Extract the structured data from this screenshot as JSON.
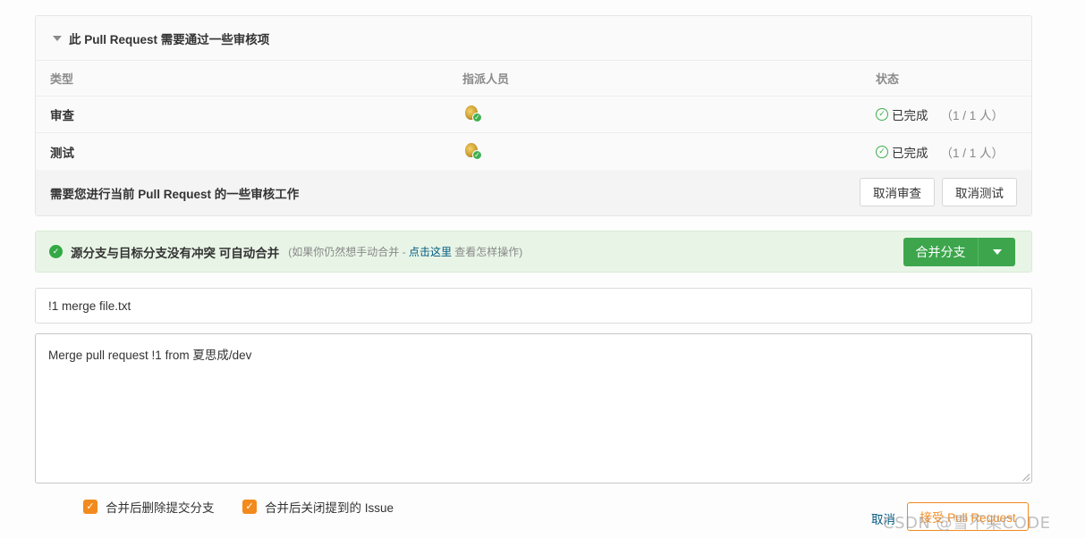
{
  "review": {
    "header": "此 Pull Request 需要通过一些审核项",
    "columns": [
      "类型",
      "指派人员",
      "状态"
    ],
    "rows": [
      {
        "type": "审查",
        "status": "已完成",
        "count": "（1 / 1 人）"
      },
      {
        "type": "测试",
        "status": "已完成",
        "count": "（1 / 1 人）"
      }
    ],
    "footer_text": "需要您进行当前 Pull Request 的一些审核工作",
    "cancel_review_label": "取消审查",
    "cancel_test_label": "取消测试"
  },
  "merge": {
    "message": "源分支与目标分支没有冲突 可自动合并",
    "hint_prefix": "(如果你仍然想手动合并 - ",
    "hint_link": "点击这里",
    "hint_suffix": " 查看怎样操作)",
    "button_label": "合并分支"
  },
  "form": {
    "title_value": "!1 merge file.txt",
    "description_value": "Merge pull request !1 from 夏思成/dev"
  },
  "options": {
    "delete_branch_label": "合并后删除提交分支",
    "close_issue_label": "合并后关闭提到的 Issue"
  },
  "actions": {
    "cancel_label": "取消",
    "accept_label": "接受 Pull Request"
  },
  "watermark": "CSDN @雪不染CODE",
  "colors": {
    "success": "#3da64d",
    "accent_orange": "#f28a1d",
    "link": "#005980"
  }
}
